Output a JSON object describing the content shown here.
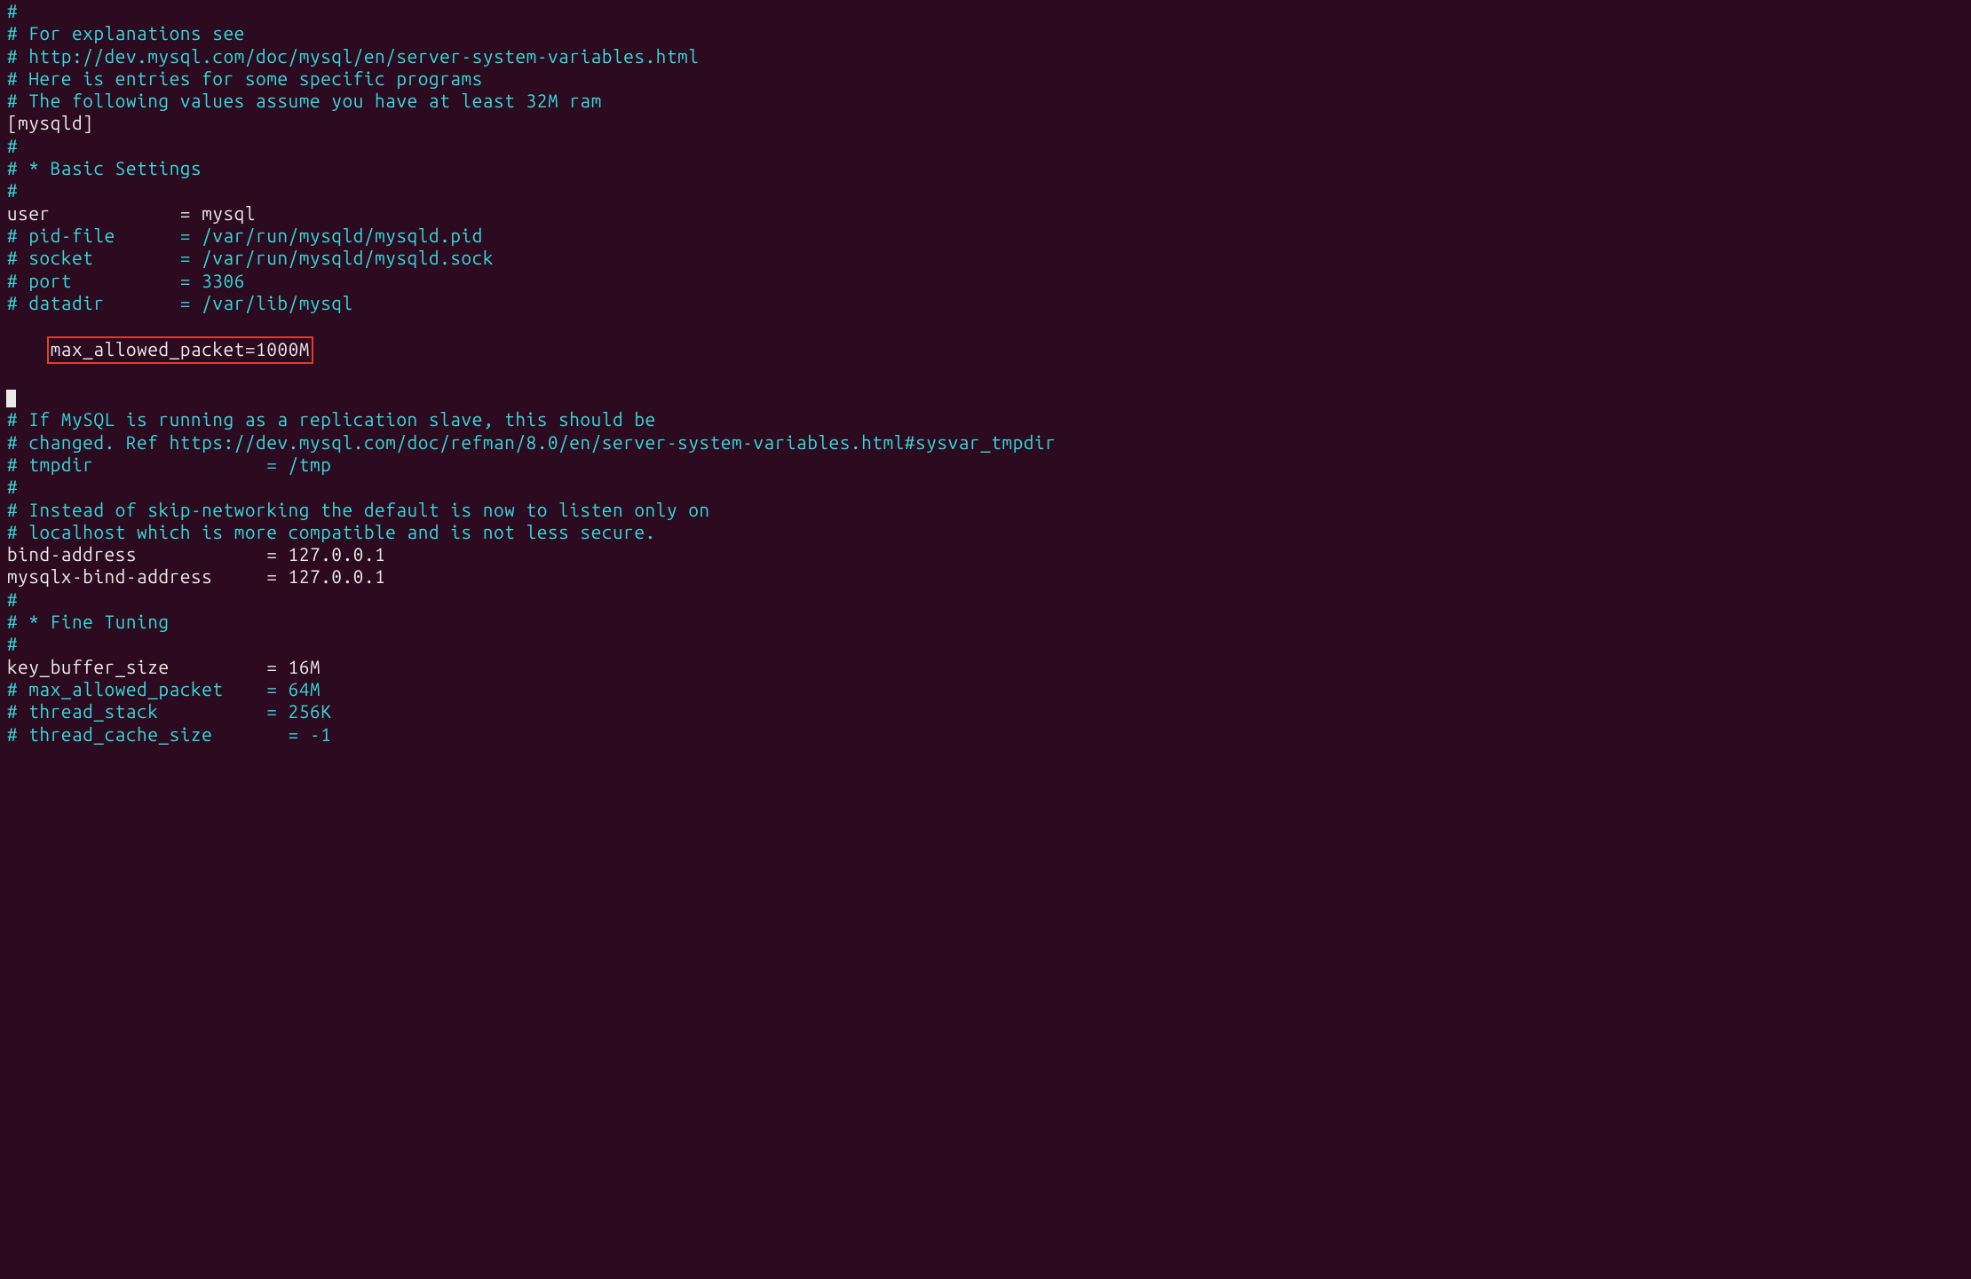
{
  "lines": {
    "l01": "#",
    "l02": "# For explanations see",
    "l03": "# http://dev.mysql.com/doc/mysql/en/server-system-variables.html",
    "l04": "",
    "l05": "# Here is entries for some specific programs",
    "l06": "# The following values assume you have at least 32M ram",
    "l07": "",
    "l08": "[mysqld]",
    "l09": "#",
    "l10": "# * Basic Settings",
    "l11": "#",
    "l12": "user            = mysql",
    "l13": "# pid-file      = /var/run/mysqld/mysqld.pid",
    "l14": "# socket        = /var/run/mysqld/mysqld.sock",
    "l15": "# port          = 3306",
    "l16": "# datadir       = /var/lib/mysql",
    "l17": "max_allowed_packet=1000M",
    "l18": "",
    "l19": "",
    "l20": "# If MySQL is running as a replication slave, this should be",
    "l21": "# changed. Ref https://dev.mysql.com/doc/refman/8.0/en/server-system-variables.html#sysvar_tmpdir",
    "l22": "# tmpdir                = /tmp",
    "l23": "#",
    "l24": "# Instead of skip-networking the default is now to listen only on",
    "l25": "# localhost which is more compatible and is not less secure.",
    "l26": "bind-address            = 127.0.0.1",
    "l27": "mysqlx-bind-address     = 127.0.0.1",
    "l28": "#",
    "l29": "# * Fine Tuning",
    "l30": "#",
    "l31": "key_buffer_size         = 16M",
    "l32": "# max_allowed_packet    = 64M",
    "l33": "# thread_stack          = 256K",
    "l34": "",
    "l35": "# thread_cache_size       = -1"
  }
}
